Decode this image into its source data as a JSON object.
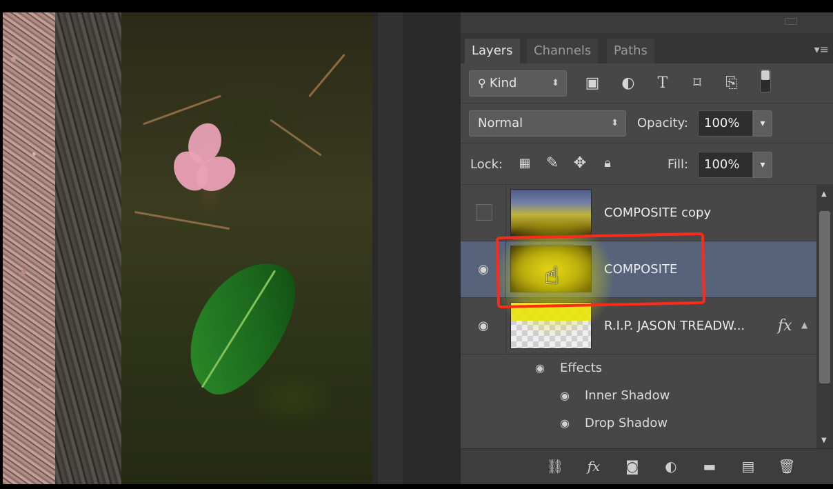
{
  "panel": {
    "tabs": [
      {
        "label": "Layers",
        "active": true
      },
      {
        "label": "Channels",
        "active": false
      },
      {
        "label": "Paths",
        "active": false
      }
    ],
    "filter": {
      "kind_label": "Kind",
      "filter_icons": [
        "image-filter-icon",
        "adjustment-filter-icon",
        "type-filter-icon",
        "shape-filter-icon",
        "smart-object-filter-icon"
      ]
    },
    "blend": {
      "mode": "Normal",
      "opacity_label": "Opacity:",
      "opacity_value": "100%"
    },
    "lock": {
      "label": "Lock:",
      "fill_label": "Fill:",
      "fill_value": "100%"
    },
    "layers": [
      {
        "name": "COMPOSITE copy",
        "visible": false,
        "selected": false
      },
      {
        "name": "COMPOSITE",
        "visible": true,
        "selected": true
      },
      {
        "name": "R.I.P. JASON  TREADW...",
        "visible": true,
        "selected": false,
        "fx": "fx"
      }
    ],
    "effects_label": "Effects",
    "effects": [
      "Inner Shadow",
      "Drop Shadow"
    ]
  },
  "colors": {
    "panel_bg": "#474747",
    "selected_row": "#56637a",
    "annotation_red": "#ff2a17",
    "highlight_yellow": "#ece600"
  }
}
